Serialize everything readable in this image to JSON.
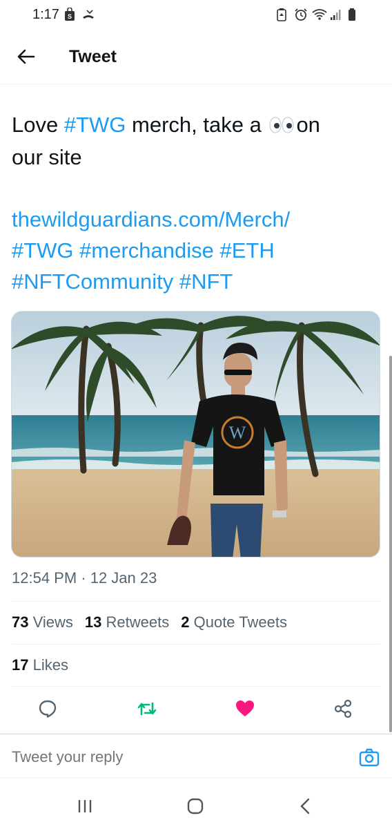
{
  "status_bar": {
    "time": "1:17",
    "left_icons": [
      "shopping-bag-icon",
      "missed-call-icon"
    ],
    "right_icons": [
      "battery-saver-icon",
      "alarm-icon",
      "wifi-icon",
      "signal-icon",
      "battery-icon"
    ]
  },
  "header": {
    "title": "Tweet"
  },
  "tweet": {
    "line1_a": "Love ",
    "line1_hashtag": "#TWG",
    "line1_b": " merch, take a ",
    "line1_c": "on",
    "line2": "our site",
    "link": "thewildguardians.com/Merch/",
    "tags_line1": "#TWG #merchandise #ETH",
    "tags_line2": "#NFTCommunity #NFT"
  },
  "timestamp": "12:54 PM · 12 Jan 23",
  "stats": {
    "views_count": "73",
    "views_label": "Views",
    "retweets_count": "13",
    "retweets_label": "Retweets",
    "quotes_count": "2",
    "quotes_label": "Quote Tweets",
    "likes_count": "17",
    "likes_label": "Likes"
  },
  "actions": {
    "reply_icon": "reply-icon",
    "retweet_icon": "retweet-icon",
    "like_icon": "heart-icon",
    "share_icon": "share-icon",
    "retweet_color": "#00ba7c",
    "like_color": "#f91880"
  },
  "reply": {
    "placeholder": "Tweet your reply"
  },
  "colors": {
    "link": "#1d9bf0",
    "text": "#0f1419",
    "muted": "#536471"
  }
}
